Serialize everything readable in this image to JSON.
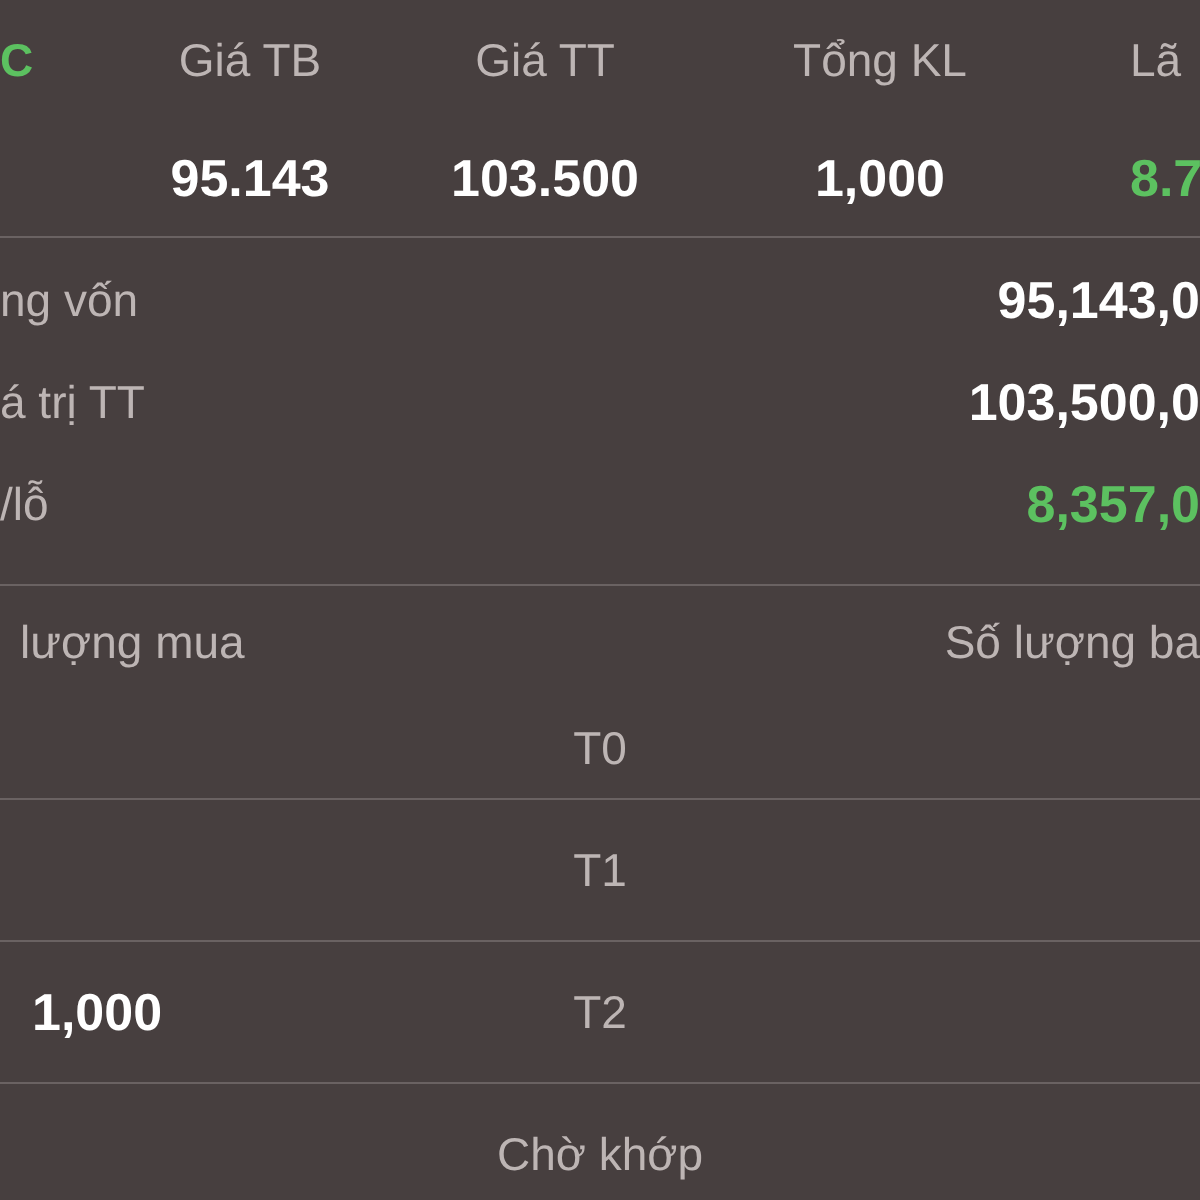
{
  "position_table": {
    "columns": [
      {
        "header": "C",
        "gain": true
      },
      {
        "header": "Giá TB",
        "gain": false
      },
      {
        "header": "Giá TT",
        "gain": false
      },
      {
        "header": "Tổng KL",
        "gain": false
      },
      {
        "header": "Lã",
        "gain": false
      }
    ],
    "row": [
      {
        "value": "95.143",
        "gain": false
      },
      {
        "value": "103.500",
        "gain": false
      },
      {
        "value": "1,000",
        "gain": false
      },
      {
        "value": "8.7",
        "gain": true
      }
    ]
  },
  "summary": [
    {
      "label": "ng vốn",
      "value": "95,143,0",
      "gain": false
    },
    {
      "label": "á trị TT",
      "value": "103,500,0",
      "gain": false
    },
    {
      "label": "/lỗ",
      "value": "8,357,0",
      "gain": true
    }
  ],
  "settlement": {
    "buy_header": "lượng mua",
    "sell_header": "Số lượng ba",
    "rows": [
      {
        "label": "T0"
      },
      {
        "label": "T1"
      },
      {
        "label": "T2",
        "buy": "1,000"
      },
      {
        "label": "Chờ khớp"
      }
    ]
  }
}
